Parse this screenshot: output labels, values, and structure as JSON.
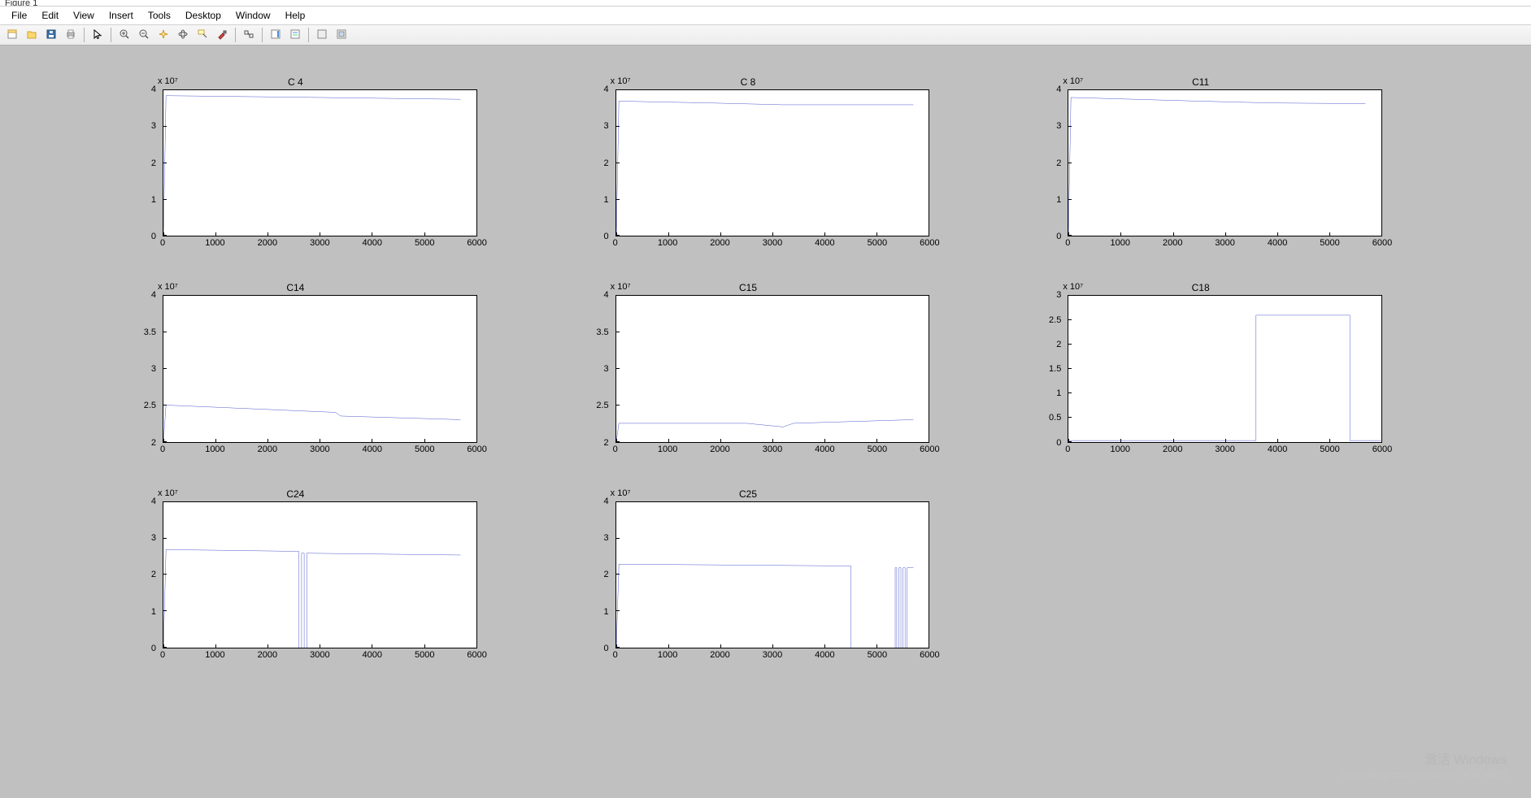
{
  "window": {
    "title": "Figure 1"
  },
  "menubar": [
    "File",
    "Edit",
    "View",
    "Insert",
    "Tools",
    "Desktop",
    "Window",
    "Help"
  ],
  "toolbar_icons": [
    "new-figure-icon",
    "open-icon",
    "save-icon",
    "print-icon",
    "|",
    "pointer-icon",
    "|",
    "zoom-in-icon",
    "zoom-out-icon",
    "pan-icon",
    "rotate3d-icon",
    "datacursor-icon",
    "brush-icon",
    "|",
    "link-icon",
    "|",
    "colorbar-icon",
    "legend-icon",
    "|",
    "hide-plot-icon",
    "show-plot-icon"
  ],
  "watermark": {
    "main": "激活 Windows",
    "sub": "https://blog.csdn.net/weixin_43074576"
  },
  "chart_data": [
    {
      "id": "c4",
      "type": "line",
      "title": "C 4",
      "exp": "x 10⁷",
      "xlim": [
        0,
        6000
      ],
      "ylim": [
        0,
        4
      ],
      "xticks": [
        0,
        1000,
        2000,
        3000,
        4000,
        5000,
        6000
      ],
      "yticks": [
        0,
        1,
        2,
        3,
        4
      ],
      "x": [
        0,
        50,
        3000,
        5700
      ],
      "y": [
        0,
        3.85,
        3.8,
        3.75
      ]
    },
    {
      "id": "c8",
      "type": "line",
      "title": "C 8",
      "exp": "x 10⁷",
      "xlim": [
        0,
        6000
      ],
      "ylim": [
        0,
        4
      ],
      "xticks": [
        0,
        1000,
        2000,
        3000,
        4000,
        5000,
        6000
      ],
      "yticks": [
        0,
        1,
        2,
        3,
        4
      ],
      "x": [
        0,
        50,
        1800,
        3200,
        5700
      ],
      "y": [
        0,
        3.7,
        3.65,
        3.6,
        3.6
      ]
    },
    {
      "id": "c11",
      "type": "line",
      "title": "C11",
      "exp": "x 10⁷",
      "xlim": [
        0,
        6000
      ],
      "ylim": [
        0,
        4
      ],
      "xticks": [
        0,
        1000,
        2000,
        3000,
        4000,
        5000,
        6000
      ],
      "yticks": [
        0,
        1,
        2,
        3,
        4
      ],
      "x": [
        0,
        50,
        2500,
        3900,
        5700
      ],
      "y": [
        0,
        3.8,
        3.7,
        3.65,
        3.63
      ]
    },
    {
      "id": "c14",
      "type": "line",
      "title": "C14",
      "exp": "x 10⁷",
      "xlim": [
        0,
        6000
      ],
      "ylim": [
        2,
        4
      ],
      "xticks": [
        0,
        1000,
        2000,
        3000,
        4000,
        5000,
        6000
      ],
      "yticks": [
        2,
        2.5,
        3,
        3.5,
        4
      ],
      "x": [
        0,
        50,
        3300,
        3400,
        5700
      ],
      "y": [
        2,
        2.5,
        2.4,
        2.35,
        2.3
      ]
    },
    {
      "id": "c15",
      "type": "line",
      "title": "C15",
      "exp": "x 10⁷",
      "xlim": [
        0,
        6000
      ],
      "ylim": [
        2,
        4
      ],
      "xticks": [
        0,
        1000,
        2000,
        3000,
        4000,
        5000,
        6000
      ],
      "yticks": [
        2,
        2.5,
        3,
        3.5,
        4
      ],
      "x": [
        0,
        50,
        2500,
        3200,
        3400,
        5700
      ],
      "y": [
        2,
        2.25,
        2.25,
        2.2,
        2.25,
        2.3
      ]
    },
    {
      "id": "c18",
      "type": "line",
      "title": "C18",
      "exp": "x 10⁷",
      "xlim": [
        0,
        6000
      ],
      "ylim": [
        0,
        3
      ],
      "xticks": [
        0,
        1000,
        2000,
        3000,
        4000,
        5000,
        6000
      ],
      "yticks": [
        0,
        0.5,
        1,
        1.5,
        2,
        2.5,
        3
      ],
      "x": [
        0,
        3600,
        3600,
        5400,
        5400,
        6000
      ],
      "y": [
        0.02,
        0.02,
        2.6,
        2.6,
        0.02,
        0.02
      ]
    },
    {
      "id": "c24",
      "type": "line",
      "title": "C24",
      "exp": "x 10⁷",
      "xlim": [
        0,
        6000
      ],
      "ylim": [
        0,
        4
      ],
      "xticks": [
        0,
        1000,
        2000,
        3000,
        4000,
        5000,
        6000
      ],
      "yticks": [
        0,
        1,
        2,
        3,
        4
      ],
      "x": [
        0,
        50,
        2600,
        2600,
        2650,
        2650,
        2700,
        2700,
        2750,
        2750,
        5700
      ],
      "y": [
        0,
        2.7,
        2.65,
        0,
        0,
        2.6,
        2.6,
        0,
        0,
        2.6,
        2.55
      ]
    },
    {
      "id": "c25",
      "type": "line",
      "title": "C25",
      "exp": "x 10⁷",
      "xlim": [
        0,
        6000
      ],
      "ylim": [
        0,
        4
      ],
      "xticks": [
        0,
        1000,
        2000,
        3000,
        4000,
        5000,
        6000
      ],
      "yticks": [
        0,
        1,
        2,
        3,
        4
      ],
      "x": [
        0,
        50,
        4500,
        4500,
        5350,
        5350,
        5380,
        5380,
        5420,
        5420,
        5460,
        5460,
        5500,
        5500,
        5540,
        5540,
        5580,
        5580,
        5700
      ],
      "y": [
        0,
        2.3,
        2.25,
        0,
        0,
        2.2,
        2.2,
        0,
        0,
        2.2,
        2.2,
        0,
        0,
        2.2,
        2.2,
        0,
        0,
        2.2,
        2.2
      ]
    }
  ]
}
